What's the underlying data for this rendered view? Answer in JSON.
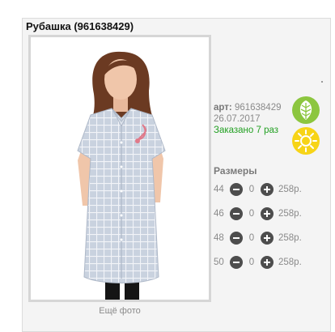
{
  "product": {
    "title": "Рубашка (961638429)",
    "more_photos_label": "Ещё фото",
    "art_label": "арт:",
    "art_value": "961638429",
    "date": "26.07.2017",
    "ordered": "Заказано 7 раз"
  },
  "icons": {
    "leaf": "leaf-icon",
    "sun": "sun-icon"
  },
  "colors": {
    "leaf_green": "#8cc63f",
    "sun_yellow": "#f7d417",
    "ordered_green": "#22a022"
  },
  "sizes": {
    "title": "Размеры",
    "rows": [
      {
        "size": "44",
        "qty": "0",
        "price": "258р."
      },
      {
        "size": "46",
        "qty": "0",
        "price": "258р."
      },
      {
        "size": "48",
        "qty": "0",
        "price": "258р."
      },
      {
        "size": "50",
        "qty": "0",
        "price": "258р."
      }
    ]
  }
}
